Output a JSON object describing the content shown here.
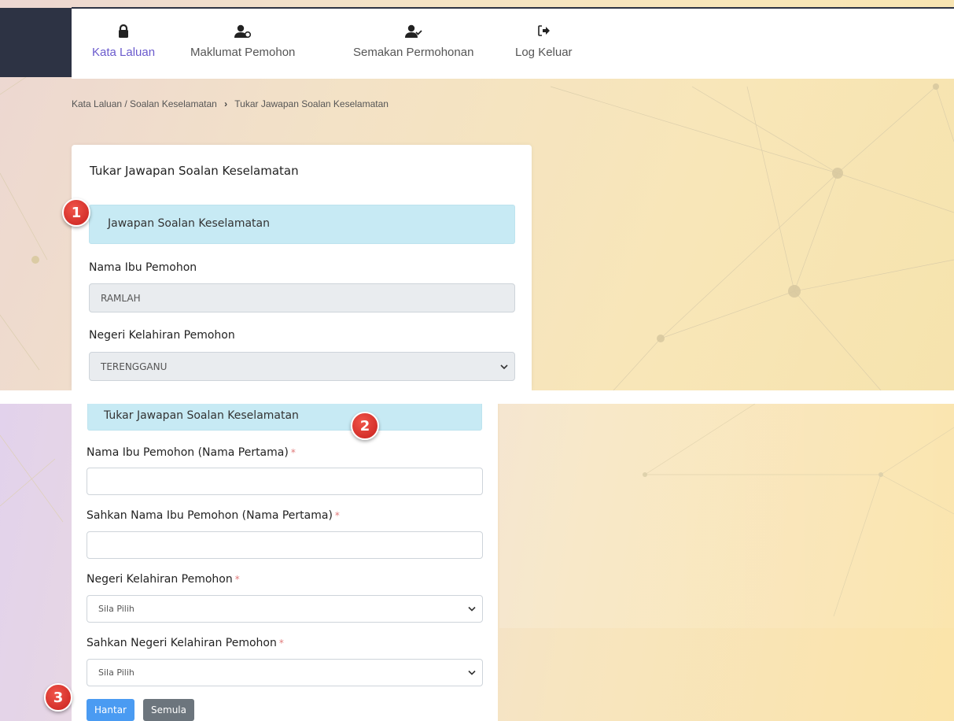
{
  "nav": {
    "items": [
      {
        "label": "Kata Laluan",
        "icon": "lock-icon"
      },
      {
        "label": "Maklumat Pemohon",
        "icon": "user-info-icon"
      },
      {
        "label": "Semakan Permohonan",
        "icon": "user-check-icon"
      },
      {
        "label": "Log Keluar",
        "icon": "sign-out-icon"
      }
    ],
    "active_color": "#6a5acd"
  },
  "breadcrumb": {
    "parent": "Kata Laluan / Soalan Keselamatan",
    "current": "Tukar Jawapan Soalan Keselamatan"
  },
  "current_answers": {
    "title": "Tukar Jawapan Soalan Keselamatan",
    "section_label": "Jawapan Soalan Keselamatan",
    "mother_name_label": "Nama Ibu Pemohon",
    "mother_name_value": "RAMLAH",
    "birth_state_label": "Negeri Kelahiran Pemohon",
    "birth_state_value": "TERENGGANU"
  },
  "change_form": {
    "section_label": "Tukar Jawapan Soalan Keselamatan",
    "mother_name_label": "Nama Ibu Pemohon (Nama Pertama)",
    "confirm_mother_name_label": "Sahkan Nama Ibu Pemohon (Nama Pertama)",
    "birth_state_label": "Negeri Kelahiran Pemohon",
    "birth_state_value": "Sila Pilih",
    "confirm_birth_state_label": "Sahkan Negeri Kelahiran Pemohon",
    "confirm_birth_state_value": "Sila Pilih",
    "required_mark": "*",
    "submit_label": "Hantar",
    "reset_label": "Semula"
  },
  "badges": [
    "1",
    "2",
    "3"
  ],
  "colors": {
    "info_bg": "#c7eaf4",
    "primary": "#4a9bf2",
    "secondary": "#6c757d",
    "badge": "#d9302a",
    "dark": "#2d3344"
  }
}
